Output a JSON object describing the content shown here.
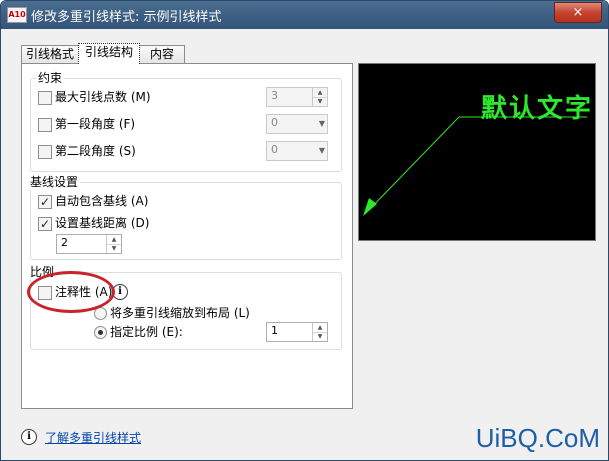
{
  "window": {
    "title": "修改多重引线样式: 示例引线样式",
    "close_label": "×",
    "app_icon_text": "A10"
  },
  "tabs": [
    {
      "label": "引线格式"
    },
    {
      "label": "引线结构"
    },
    {
      "label": "内容"
    }
  ],
  "constraints": {
    "title": "约束",
    "max_points": {
      "label": "最大引线点数 (M)",
      "checked": false,
      "value": "3"
    },
    "first_angle": {
      "label": "第一段角度 (F)",
      "checked": false,
      "value": "0"
    },
    "second_angle": {
      "label": "第二段角度 (S)",
      "checked": false,
      "value": "0"
    }
  },
  "landing": {
    "title": "基线设置",
    "auto_include": {
      "label": "自动包含基线 (A)",
      "checked": true
    },
    "set_distance": {
      "label": "设置基线距离 (D)",
      "checked": true
    },
    "distance_value": "2"
  },
  "scale": {
    "title": "比例",
    "annotative": {
      "label": "注释性 (A)",
      "checked": false
    },
    "info_icon": "info-icon",
    "scale_to_layout": {
      "label": "将多重引线缩放到布局 (L)",
      "selected": false
    },
    "specify_scale": {
      "label": "指定比例 (E):",
      "selected": true,
      "value": "1"
    }
  },
  "preview": {
    "text": "默认文字",
    "line_color": "#2ee82e"
  },
  "footer": {
    "info_icon": "info-icon",
    "link": "了解多重引线样式"
  },
  "watermark": "UiBQ.CoM"
}
